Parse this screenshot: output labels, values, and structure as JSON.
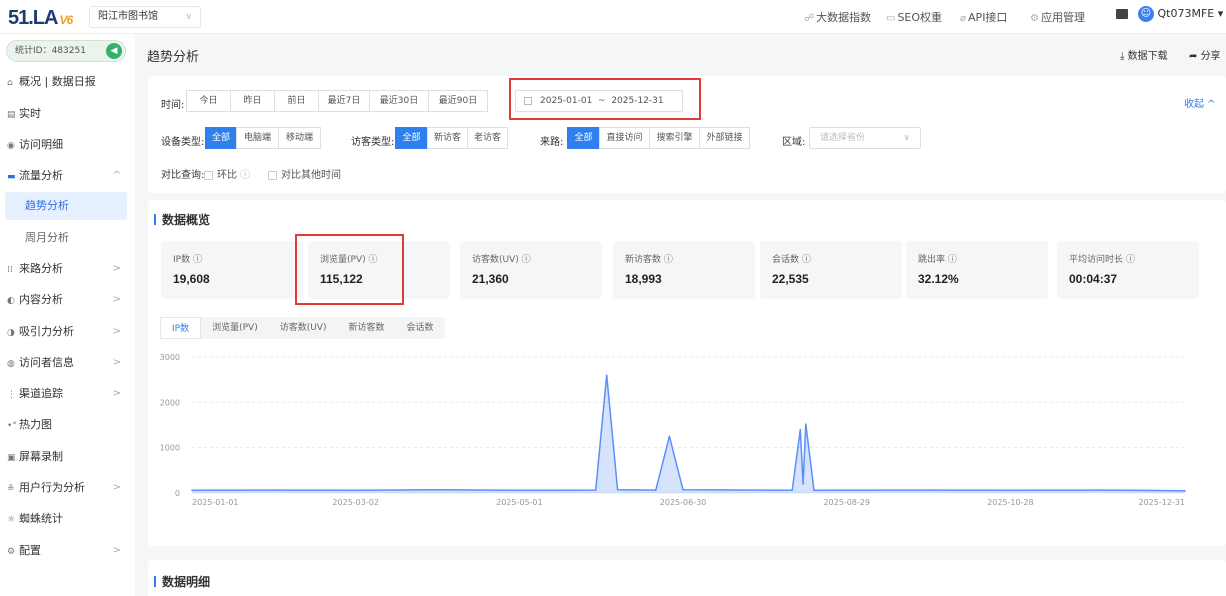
{
  "header": {
    "logo_text": "51.LA",
    "logo_version": "V6",
    "site_select": "阳江市图书馆",
    "nav": [
      {
        "label": "大数据指数",
        "icon": "trend-icon"
      },
      {
        "label": "SEO权重",
        "icon": "seo-icon"
      },
      {
        "label": "API接口",
        "icon": "link-icon"
      },
      {
        "label": "应用管理",
        "icon": "gear-icon"
      }
    ],
    "user_name": "Qt073MFE ▾"
  },
  "sidebar": {
    "stat_id": "统计ID：483251",
    "items": [
      {
        "label": "概况 | 数据日报",
        "icon": "home-icon"
      },
      {
        "label": "实时",
        "icon": "doc-icon"
      },
      {
        "label": "访问明细",
        "icon": "eye-icon"
      },
      {
        "label": "流量分析",
        "icon": "monitor-icon",
        "arrow": "^"
      },
      {
        "label": "趋势分析"
      },
      {
        "label": "周月分析"
      },
      {
        "label": "来路分析",
        "icon": "source-icon",
        "arrow": ">"
      },
      {
        "label": "内容分析",
        "icon": "content-icon",
        "arrow": ">"
      },
      {
        "label": "吸引力分析",
        "icon": "magnet-icon",
        "arrow": ">"
      },
      {
        "label": "访问者信息",
        "icon": "visitor-icon",
        "arrow": ">"
      },
      {
        "label": "渠道追踪",
        "icon": "channel-icon",
        "arrow": ">"
      },
      {
        "label": "热力图",
        "icon": "heat-icon"
      },
      {
        "label": "屏幕录制",
        "icon": "record-icon"
      },
      {
        "label": "用户行为分析",
        "icon": "user-icon",
        "arrow": ">"
      },
      {
        "label": "蜘蛛统计",
        "icon": "spider-icon"
      },
      {
        "label": "配置",
        "icon": "config-icon",
        "arrow": ">"
      }
    ]
  },
  "page": {
    "title": "趋势分析",
    "download_label": "数据下载",
    "share_label": "分享"
  },
  "filters": {
    "time_label": "时间:",
    "time_options": [
      "今日",
      "昨日",
      "前日",
      "最近7日",
      "最近30日",
      "最近90日"
    ],
    "date_start": "2025-01-01",
    "date_sep": "~",
    "date_end": "2025-12-31",
    "collapse_label": "收起 ^",
    "device_label": "设备类型:",
    "device_options": [
      "全部",
      "电脑端",
      "移动端"
    ],
    "visitor_label": "访客类型:",
    "visitor_options": [
      "全部",
      "新访客",
      "老访客"
    ],
    "source_label": "来路:",
    "source_options": [
      "全部",
      "直接访问",
      "搜索引擎",
      "外部链接"
    ],
    "region_label": "区域:",
    "region_placeholder": "请选择省份",
    "compare_label": "对比查询:",
    "compare_opt1": "环比",
    "compare_opt2": "对比其他时间"
  },
  "overview": {
    "title": "数据概览",
    "cards": [
      {
        "label": "IP数",
        "value": "19,608"
      },
      {
        "label": "浏览量(PV)",
        "value": "115,122"
      },
      {
        "label": "访客数(UV)",
        "value": "21,360"
      },
      {
        "label": "新访客数",
        "value": "18,993"
      },
      {
        "label": "会话数",
        "value": "22,535"
      },
      {
        "label": "跳出率",
        "value": "32.12%"
      },
      {
        "label": "平均访问时长",
        "value": "00:04:37"
      }
    ],
    "tabs": [
      "IP数",
      "浏览量(PV)",
      "访客数(UV)",
      "新访客数",
      "会话数"
    ]
  },
  "chart_data": {
    "type": "area",
    "ylim": [
      0,
      3000
    ],
    "y_ticks": [
      0,
      1000,
      2000,
      3000
    ],
    "x_tick_labels": [
      "2025-01-01",
      "2025-03-02",
      "2025-05-01",
      "2025-06-30",
      "2025-08-29",
      "2025-10-28",
      "2025-12-31"
    ],
    "x_range": [
      "2025-01-01",
      "2025-12-31"
    ],
    "series": [
      {
        "color": "#5b8ff9",
        "points": [
          [
            "2025-01-01",
            60
          ],
          [
            "2025-02-01",
            65
          ],
          [
            "2025-03-02",
            60
          ],
          [
            "2025-04-01",
            70
          ],
          [
            "2025-05-01",
            60
          ],
          [
            "2025-05-29",
            65
          ],
          [
            "2025-06-02",
            2600
          ],
          [
            "2025-06-06",
            70
          ],
          [
            "2025-06-20",
            65
          ],
          [
            "2025-06-25",
            1250
          ],
          [
            "2025-06-30",
            70
          ],
          [
            "2025-08-09",
            60
          ],
          [
            "2025-08-12",
            1400
          ],
          [
            "2025-08-13",
            200
          ],
          [
            "2025-08-14",
            1520
          ],
          [
            "2025-08-17",
            60
          ],
          [
            "2025-09-30",
            65
          ],
          [
            "2025-10-28",
            60
          ],
          [
            "2025-12-01",
            65
          ],
          [
            "2025-12-31",
            50
          ]
        ]
      }
    ],
    "grid": true
  },
  "detail": {
    "title": "数据明细"
  }
}
